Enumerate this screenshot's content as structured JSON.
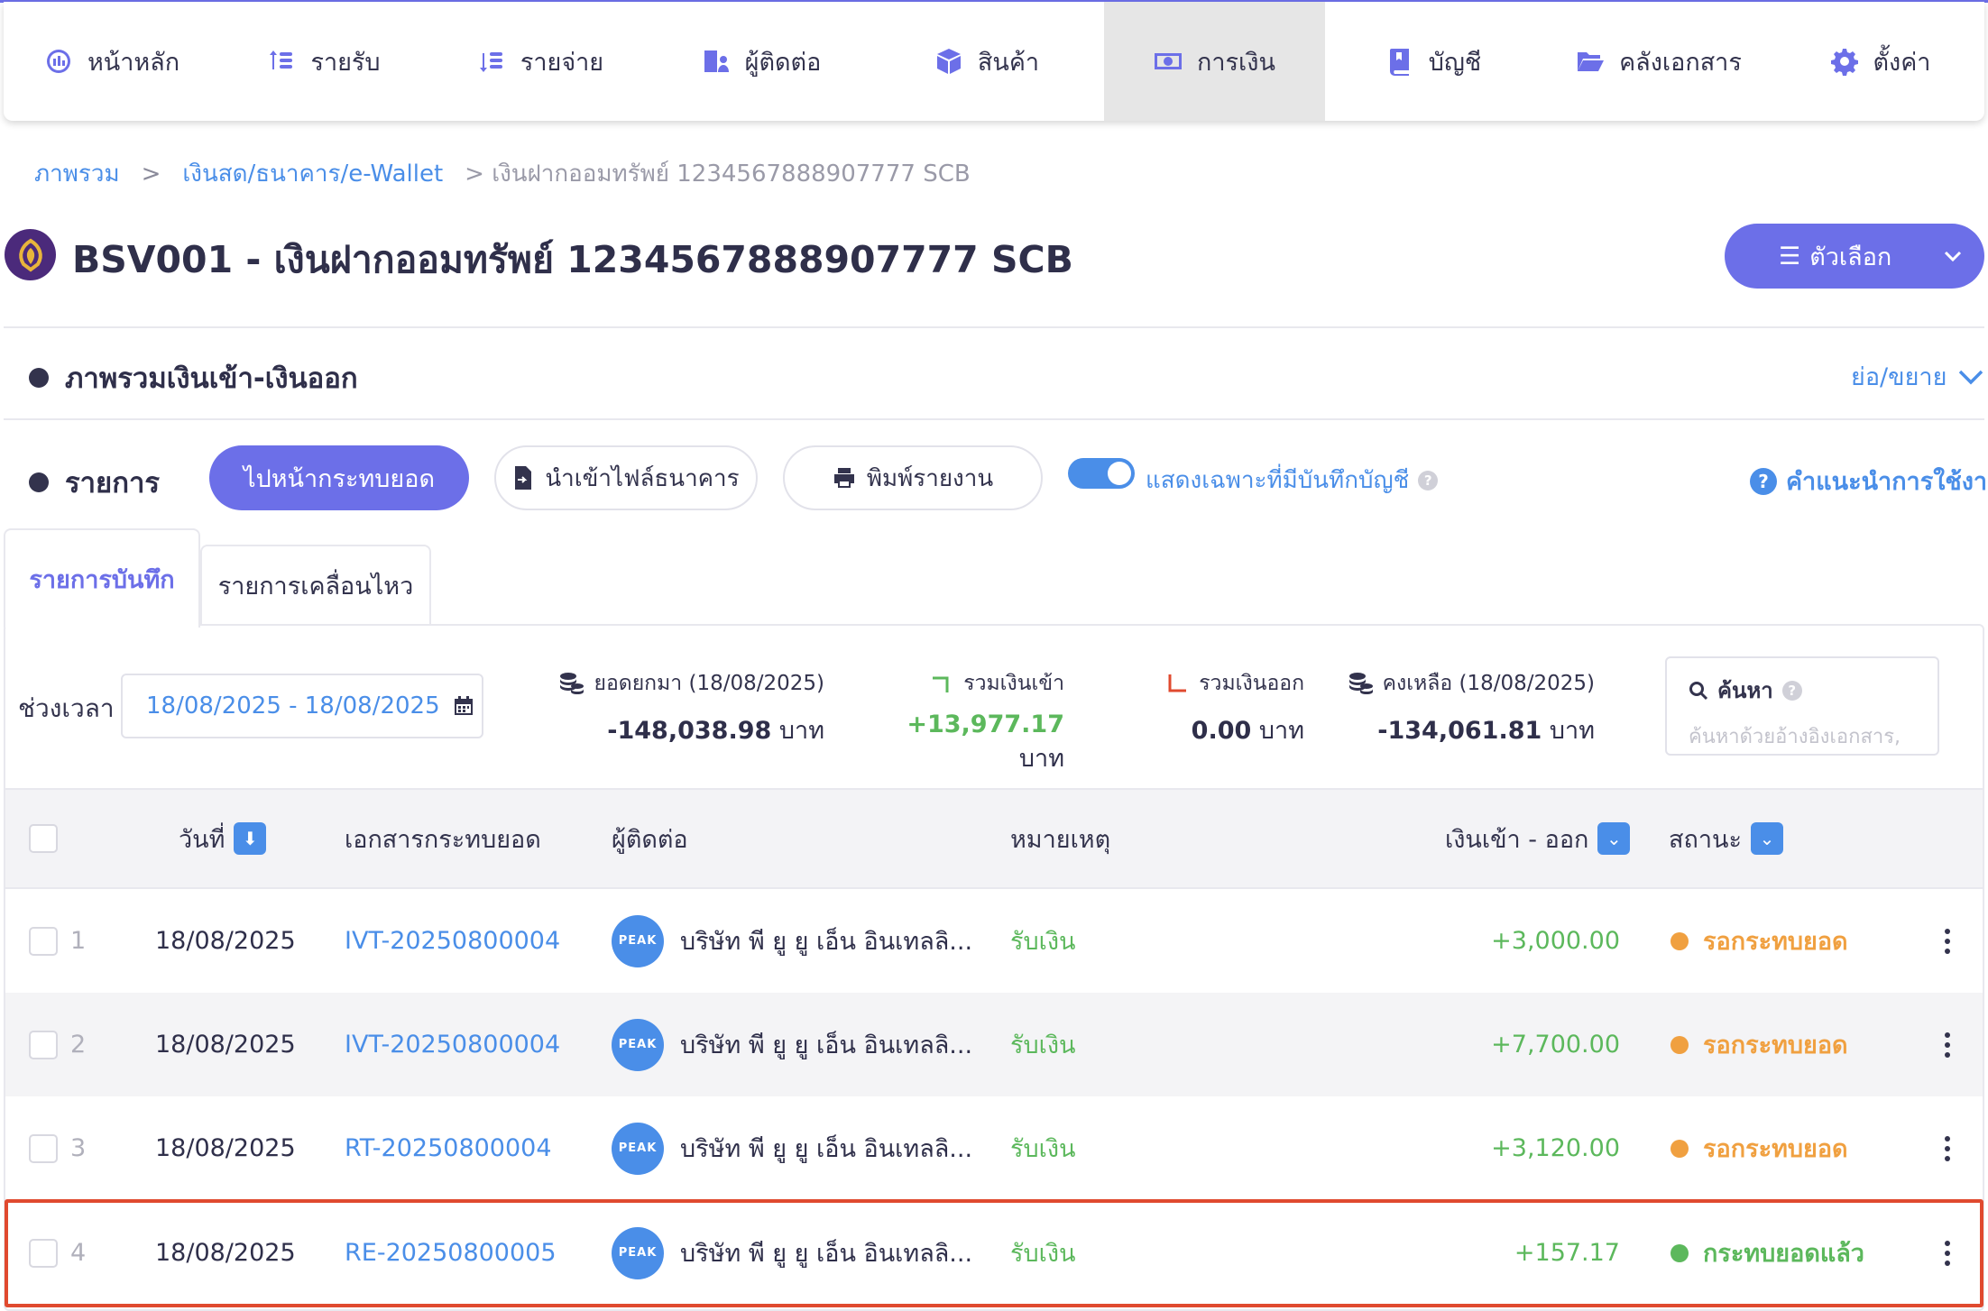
{
  "nav": {
    "items": [
      {
        "label": "หน้าหลัก",
        "icon": "dashboard-icon"
      },
      {
        "label": "รายรับ",
        "icon": "income-icon"
      },
      {
        "label": "รายจ่าย",
        "icon": "expense-icon"
      },
      {
        "label": "ผู้ติดต่อ",
        "icon": "contacts-icon"
      },
      {
        "label": "สินค้า",
        "icon": "product-box-icon"
      },
      {
        "label": "การเงิน",
        "icon": "money-icon"
      },
      {
        "label": "บัญชี",
        "icon": "ledger-book-icon"
      },
      {
        "label": "คลังเอกสาร",
        "icon": "folder-icon"
      },
      {
        "label": "ตั้งค่า",
        "icon": "gear-icon"
      }
    ],
    "active": "การเงิน"
  },
  "breadcrumb": {
    "overview": "ภาพรวม",
    "sep": ">",
    "cash": "เงินสด/ธนาคาร/e-Wallet",
    "current": "> เงินฝากออมทรัพย์ 1234567888907777 SCB"
  },
  "page": {
    "title": "BSV001 - เงินฝากออมทรัพย์ 1234567888907777 SCB",
    "options_label": "ตัวเลือก",
    "accent": "#6c6fe8",
    "link_color": "#4a8ee8"
  },
  "overview_section": {
    "title": "ภาพรวมเงินเข้า-เงินออก",
    "collapse_label": "ย่อ/ขยาย"
  },
  "list_section": {
    "title": "รายการ",
    "go_reconcile": "ไปหน้ากระทบยอด",
    "import_bank": "นำเข้าไฟล์ธนาคาร",
    "print_report": "พิมพ์รายงาน",
    "toggle_label": "แสดงเฉพาะที่มีบันทึกบัญชี",
    "toggle_on": true,
    "help": "คำแนะนำการใช้งาน"
  },
  "tabs": {
    "active": "รายการบันทึก",
    "other": "รายการเคลื่อนไหว"
  },
  "filters": {
    "range_label": "ช่วงเวลา",
    "date_range": "18/08/2025 - 18/08/2025",
    "search_title": "ค้นหา",
    "search_placeholder": "ค้นหาด้วยอ้างอิงเอกสาร,"
  },
  "stats": {
    "opening_label": "ยอดยกมา (18/08/2025)",
    "opening_value": "-148,038.98",
    "in_label": "รวมเงินเข้า",
    "in_value": "+13,977.17",
    "out_label": "รวมเงินออก",
    "out_value": "0.00",
    "balance_label": "คงเหลือ (18/08/2025)",
    "balance_value": "-134,061.81",
    "unit": "บาท"
  },
  "table": {
    "headers": {
      "date": "วันที่",
      "doc": "เอกสารกระทบยอด",
      "contact": "ผู้ติดต่อ",
      "note": "หมายเหตุ",
      "amount": "เงินเข้า - ออก",
      "status": "สถานะ"
    },
    "rows": [
      {
        "num": "1",
        "date": "18/08/2025",
        "doc": "IVT-20250800004",
        "avatar": "PEAK",
        "contact": "บริษัท พี ยู ยู เอ็น อินเทลลิ...",
        "note": "รับเงิน",
        "amount": "+3,000.00",
        "status": "รอกระทบยอด",
        "status_color": "#f0a040"
      },
      {
        "num": "2",
        "date": "18/08/2025",
        "doc": "IVT-20250800004",
        "avatar": "PEAK",
        "contact": "บริษัท พี ยู ยู เอ็น อินเทลลิ...",
        "note": "รับเงิน",
        "amount": "+7,700.00",
        "status": "รอกระทบยอด",
        "status_color": "#f0a040"
      },
      {
        "num": "3",
        "date": "18/08/2025",
        "doc": "RT-20250800004",
        "avatar": "PEAK",
        "contact": "บริษัท พี ยู ยู เอ็น อินเทลลิ...",
        "note": "รับเงิน",
        "amount": "+3,120.00",
        "status": "รอกระทบยอด",
        "status_color": "#f0a040"
      },
      {
        "num": "4",
        "date": "18/08/2025",
        "doc": "RE-20250800005",
        "avatar": "PEAK",
        "contact": "บริษัท พี ยู ยู เอ็น อินเทลลิ...",
        "note": "รับเงิน",
        "amount": "+157.17",
        "status": "กระทบยอดแล้ว",
        "status_color": "#5cb85c"
      }
    ]
  }
}
